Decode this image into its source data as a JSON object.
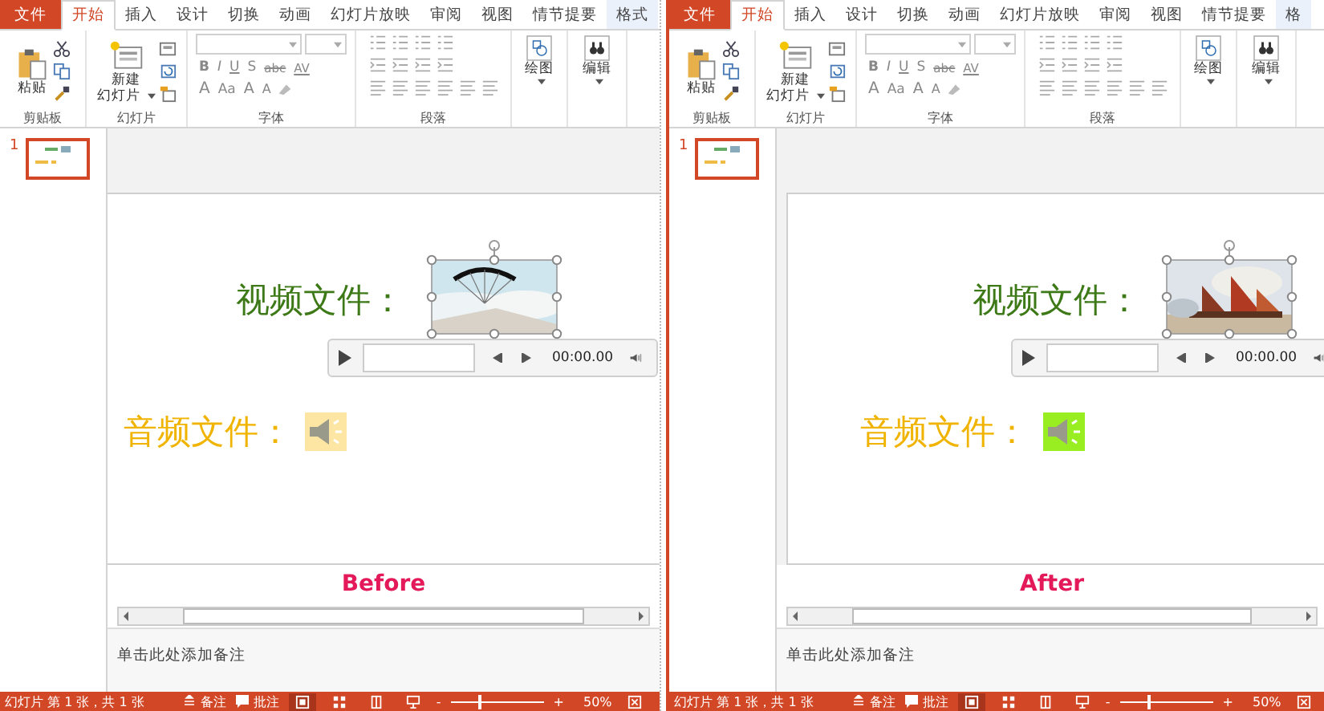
{
  "panels": [
    {
      "tabs": [
        {
          "label": "文件",
          "kind": "file",
          "selected": false
        },
        {
          "label": "开始",
          "kind": "tab",
          "selected": true
        },
        {
          "label": "插入",
          "kind": "tab",
          "selected": false
        },
        {
          "label": "设计",
          "kind": "tab",
          "selected": false
        },
        {
          "label": "切换",
          "kind": "tab",
          "selected": false
        },
        {
          "label": "动画",
          "kind": "tab",
          "selected": false
        },
        {
          "label": "幻灯片放映",
          "kind": "tab",
          "selected": false
        },
        {
          "label": "审阅",
          "kind": "tab",
          "selected": false
        },
        {
          "label": "视图",
          "kind": "tab",
          "selected": false
        },
        {
          "label": "情节提要",
          "kind": "tab",
          "selected": false
        },
        {
          "label": "格式",
          "kind": "context",
          "selected": false
        }
      ],
      "ribbon": {
        "paste": "粘贴",
        "new_slide": [
          "新建",
          "幻灯片"
        ],
        "font_row1": [
          "B",
          "I",
          "U",
          "S",
          "abc",
          "AV"
        ],
        "font_row2": [
          "A",
          "Aa",
          "A",
          "A"
        ],
        "drawing": "绘图",
        "editing": "编辑",
        "groups": [
          "剪贴板",
          "幻灯片",
          "字体",
          "段落"
        ]
      },
      "slides": [
        {
          "number": "1",
          "selected": true
        }
      ],
      "slide": {
        "video_label": "视频文件：",
        "time": "00:00.00",
        "audio_label": "音频文件：",
        "audio_icon": {
          "color": "#fde6a4"
        }
      },
      "caption": "Before",
      "notes": "单击此处添加备注",
      "status_bar": {
        "slide_info": "幻灯片 第 1 张，共 1 张",
        "notes": "备注",
        "comments": "批注",
        "zoom_out": "-",
        "zoom": {
          "level": 0.3
        },
        "zoom_in": "+",
        "zoom_text": "50%"
      }
    },
    {
      "tabs": [
        {
          "label": "文件",
          "kind": "file",
          "selected": false
        },
        {
          "label": "开始",
          "kind": "tab",
          "selected": true
        },
        {
          "label": "插入",
          "kind": "tab",
          "selected": false
        },
        {
          "label": "设计",
          "kind": "tab",
          "selected": false
        },
        {
          "label": "切换",
          "kind": "tab",
          "selected": false
        },
        {
          "label": "动画",
          "kind": "tab",
          "selected": false
        },
        {
          "label": "幻灯片放映",
          "kind": "tab",
          "selected": false
        },
        {
          "label": "审阅",
          "kind": "tab",
          "selected": false
        },
        {
          "label": "视图",
          "kind": "tab",
          "selected": false
        },
        {
          "label": "情节提要",
          "kind": "tab",
          "selected": false
        },
        {
          "label": "格",
          "kind": "context",
          "selected": false
        }
      ],
      "ribbon": {
        "paste": "粘贴",
        "new_slide": [
          "新建",
          "幻灯片"
        ],
        "font_row1": [
          "B",
          "I",
          "U",
          "S",
          "abc",
          "AV"
        ],
        "font_row2": [
          "A",
          "Aa",
          "A",
          "A"
        ],
        "drawing": "绘图",
        "editing": "编辑",
        "groups": [
          "剪贴板",
          "幻灯片",
          "字体",
          "段落"
        ]
      },
      "slides": [
        {
          "number": "1",
          "selected": true
        }
      ],
      "slide": {
        "video_label": "视频文件：",
        "time": "00:00.00",
        "audio_label": "音频文件：",
        "audio_icon": {
          "color": "#99ee22"
        }
      },
      "caption": "After",
      "notes": "单击此处添加备注",
      "status_bar": {
        "slide_info": "幻灯片 第 1 张，共 1 张",
        "notes": "备注",
        "comments": "批注",
        "zoom_out": "-",
        "zoom": {
          "level": 0.3
        },
        "zoom_in": "+",
        "zoom_text": "50%"
      }
    }
  ]
}
